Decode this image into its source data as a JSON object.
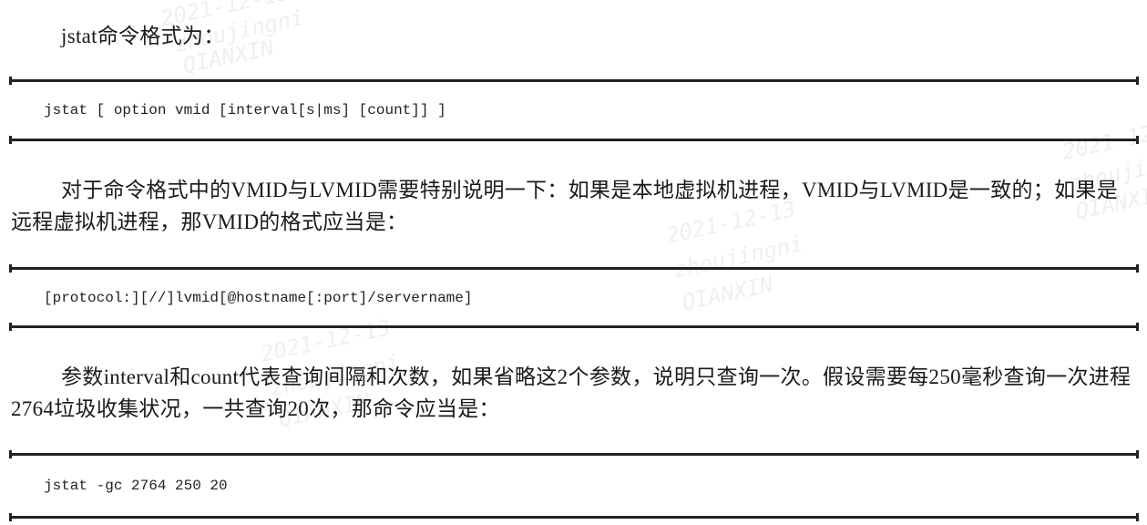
{
  "paragraphs": [
    "jstat命令格式为：",
    "对于命令格式中的VMID与LVMID需要特别说明一下：如果是本地虚拟机进程，VMID与LVMID是一致的；如果是远程虚拟机进程，那VMID的格式应当是：",
    "参数interval和count代表查询间隔和次数，如果省略这2个参数，说明只查询一次。假设需要每250毫秒查询一次进程2764垃圾收集状况，一共查询20次，那命令应当是："
  ],
  "code_blocks": [
    "jstat [ option vmid [interval[s|ms] [count]] ]",
    "[protocol:][//]lvmid[@hostname[:port]/servername]",
    "jstat -gc 2764 250 20"
  ],
  "watermark": {
    "date": "2021-12-13",
    "user": "zhoujingni",
    "org": "QIANXIN"
  }
}
